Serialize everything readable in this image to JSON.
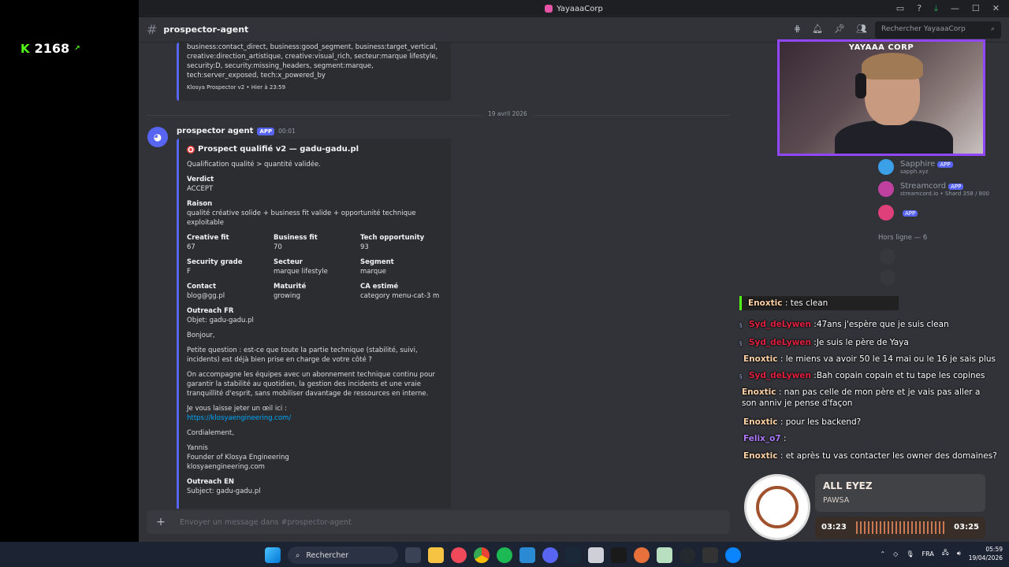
{
  "kick": {
    "count": "2168"
  },
  "window": {
    "title": "YayaaaCorp"
  },
  "channel": {
    "name": "prospector-agent",
    "search_placeholder": "Rechercher YayaaaCorp"
  },
  "prev_embed": {
    "tags": "business:contact_direct, business:good_segment, business:target_vertical, creative:direction_artistique, creative:visual_rich, secteur:marque lifestyle, security:D, security:missing_headers, segment:marque, tech:server_exposed, tech:x_powered_by",
    "footer": "Klosya Prospector v2 • Hier à 23:59"
  },
  "date_divider": "19 avril 2026",
  "message": {
    "author": "prospector agent",
    "app_badge": "APP",
    "time": "00:01",
    "embed": {
      "title": "Prospect qualifié v2 — gadu-gadu.pl",
      "subtitle": "Qualification qualité > quantité validée.",
      "verdict_label": "Verdict",
      "verdict": "ACCEPT",
      "raison_label": "Raison",
      "raison": "qualité créative solide + business fit valide + opportunité technique exploitable",
      "fields_row1": [
        {
          "label": "Creative fit",
          "value": "67"
        },
        {
          "label": "Business fit",
          "value": "70"
        },
        {
          "label": "Tech opportunity",
          "value": "93"
        }
      ],
      "fields_row2": [
        {
          "label": "Security grade",
          "value": "F"
        },
        {
          "label": "Secteur",
          "value": "marque lifestyle"
        },
        {
          "label": "Segment",
          "value": "marque"
        }
      ],
      "fields_row3": [
        {
          "label": "Contact",
          "value": "blog@gg.pl"
        },
        {
          "label": "Maturité",
          "value": "growing"
        },
        {
          "label": "CA estimé",
          "value": "category menu-cat-3 m"
        }
      ],
      "outreach_fr_label": "Outreach FR",
      "objet": "Objet: gadu-gadu.pl",
      "bonjour": "Bonjour,",
      "p1": "Petite question : est-ce que toute la partie technique (stabilité, suivi, incidents) est déjà bien prise en charge de votre côté ?",
      "p2": "On accompagne les équipes avec un abonnement technique continu pour garantir la stabilité au quotidien, la gestion des incidents et une vraie tranquillité d'esprit, sans mobiliser davantage de ressources en interne.",
      "p3": "Je vous laisse jeter un œil ici :",
      "link": "https://klosyaengineering.com/",
      "cordialement": "Cordialement,",
      "sig_name": "Yannis",
      "sig_title": "Founder of Klosya Engineering",
      "sig_site": "klosyaengineering.com",
      "outreach_en_label": "Outreach EN",
      "subject": "Subject: gadu-gadu.pl"
    }
  },
  "composer": {
    "placeholder": "Envoyer un message dans #prospector-agent"
  },
  "members": [
    {
      "name": "Sapphire",
      "sub": "sapph.xyz",
      "badge": "APP",
      "color": "#3ba0e8"
    },
    {
      "name": "Streamcord",
      "sub": "streamcord.io • Shard 358 / 800",
      "badge": "APP",
      "color": "#c040a0"
    },
    {
      "name": "",
      "sub": "",
      "badge": "APP",
      "color": "#e0407a"
    }
  ],
  "offline_header": "Hors ligne — 6",
  "cam_label": "YAYAAA CORP",
  "chat": [
    {
      "user": "Enoxtic",
      "text": " : tes clean",
      "cls": "u-enox",
      "highlight": true
    },
    {
      "user": "Syd_deLywen",
      "text": " :47ans j'espère que je suis clean",
      "cls": "u-syd"
    },
    {
      "user": "Syd_deLywen",
      "text": " :Je suis le père de Yaya",
      "cls": "u-syd"
    },
    {
      "user": "Enoxtic",
      "text": " : le miens va avoir 50 le 14 mai ou le 16 je sais plus",
      "cls": "u-enox"
    },
    {
      "user": "Syd_deLywen",
      "text": " :Bah copain copain et tu tape les copines",
      "cls": "u-syd"
    },
    {
      "user": "Enoxtic",
      "text": " : nan pas celle de mon père et je vais pas aller a son anniv je pense d'façon",
      "cls": "u-enox"
    },
    {
      "user": "Enoxtic",
      "text": " : pour les backend?",
      "cls": "u-enox"
    },
    {
      "user": "Felix_o7",
      "text": " : ",
      "cls": "u-felix"
    },
    {
      "user": "Enoxtic",
      "text": " : et après tu vas contacter les owner des domaines?",
      "cls": "u-enox"
    }
  ],
  "music": {
    "title": "ALL EYEZ",
    "artist": "PAWSA",
    "elapsed": "03:23",
    "total": "03:25",
    "progress": 0.99
  },
  "taskbar": {
    "search": "Rechercher",
    "lang": "FRA",
    "time": "05:59",
    "date": "19/04/2026"
  }
}
